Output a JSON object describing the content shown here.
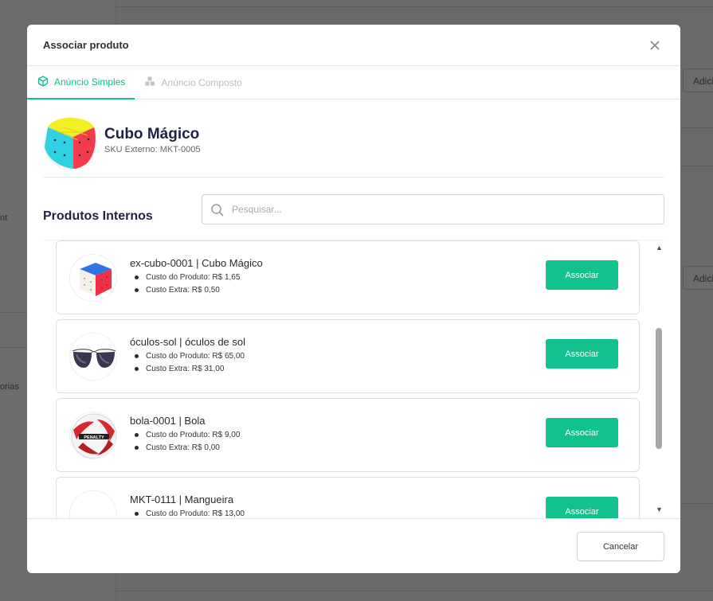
{
  "background": {
    "sidebar_texts": [
      "nt",
      "orias"
    ],
    "button_label": "Adici"
  },
  "modal": {
    "title": "Associar produto",
    "close_icon": "close-icon"
  },
  "tabs": [
    {
      "label": "Anúncio Simples",
      "icon": "cube-icon",
      "active": true
    },
    {
      "label": "Anúncio Composto",
      "icon": "boxes-icon",
      "active": false
    }
  ],
  "product": {
    "name": "Cubo Mágico",
    "sku": "SKU Externo: MKT-0005"
  },
  "internal": {
    "title": "Produtos Internos",
    "search_placeholder": "Pesquisar..."
  },
  "items": [
    {
      "title": "ex-cubo-0001 | Cubo Mágico",
      "cost": "Custo do Produto: R$ 1,65",
      "extra": "Custo Extra: R$ 0,50",
      "button": "Associar",
      "image": "cube-image"
    },
    {
      "title": "óculos-sol | óculos de sol",
      "cost": "Custo do Produto: R$ 65,00",
      "extra": "Custo Extra: R$ 31,00",
      "button": "Associar",
      "image": "sunglasses-image"
    },
    {
      "title": "bola-0001 | Bola",
      "cost": "Custo do Produto: R$ 9,00",
      "extra": "Custo Extra: R$ 0,00",
      "button": "Associar",
      "image": "ball-image"
    },
    {
      "title": "MKT-0111 | Mangueira",
      "cost": "Custo do Produto: R$ 13,00",
      "extra": "",
      "button": "Associar",
      "image": "hose-image"
    }
  ],
  "footer": {
    "cancel_label": "Cancelar"
  },
  "colors": {
    "accent": "#11c28e",
    "title": "#1f2340"
  }
}
